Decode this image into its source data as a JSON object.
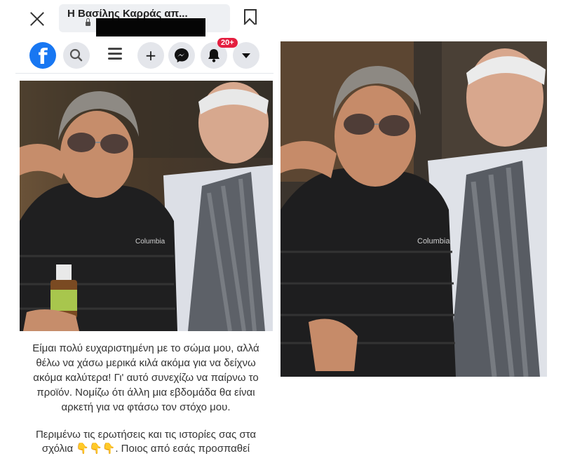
{
  "browser": {
    "page_title": "Η Βασίλης Καρράς απ..."
  },
  "fb_nav": {
    "logo": "f",
    "search_icon": "search-icon",
    "menu_icon": "menu-icon",
    "add_icon": "+",
    "messenger_icon": "messenger-icon",
    "notifications_icon": "bell-icon",
    "notifications_badge": "20+",
    "dropdown_icon": "caret-down-icon"
  },
  "post": {
    "caption": "Είμαι πολύ ευχαριστημένη με το σώμα μου, αλλά θέλω να χάσω μερικά κιλά ακόμα για να δείχνω ακόμα καλύτερα! Γι' αυτό συνεχίζω να παίρνω το προϊόν. Νομίζω ότι άλλη μια εβδομάδα θα είναι αρκετή για να φτάσω τον στόχο μου.",
    "caption_cont": "Περιμένω τις ερωτήσεις και τις ιστορίες σας στα σχόλια 👇👇👇. Ποιος από εσάς προσπαθεί",
    "jacket_logo": "Columbia"
  },
  "right_photo": {
    "jacket_logo": "Columbia"
  },
  "colors": {
    "fb_blue": "#1877f2",
    "badge_red": "#e41e3f"
  }
}
